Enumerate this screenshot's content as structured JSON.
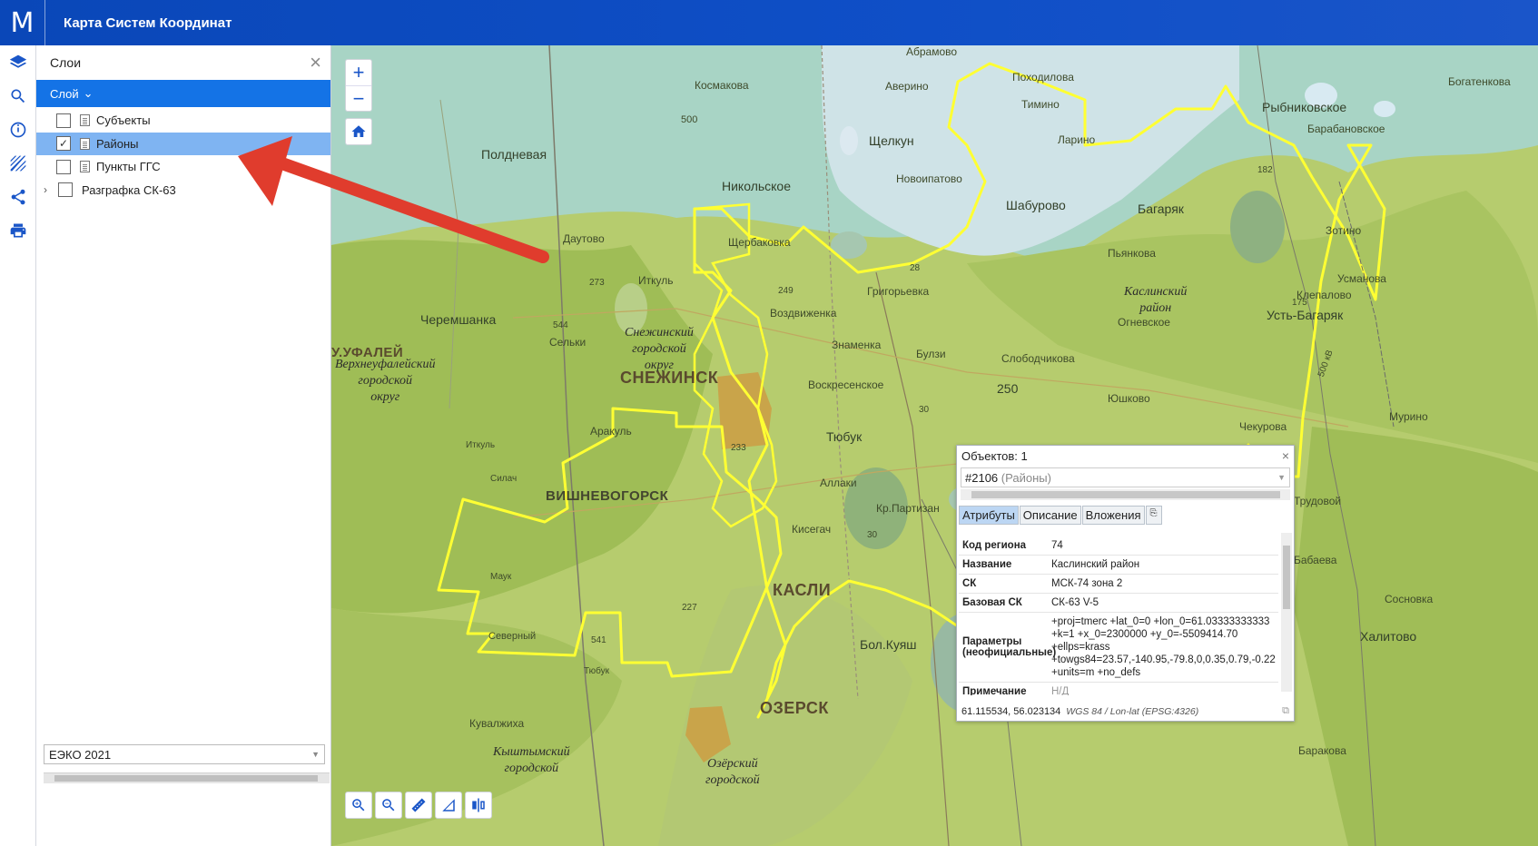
{
  "header": {
    "logo": "M",
    "title": "Карта Систем Координат"
  },
  "toolbar": {
    "tools": [
      "layers-icon",
      "search-icon",
      "info-icon",
      "hatch-icon",
      "share-icon",
      "print-icon"
    ]
  },
  "layers_panel": {
    "title": "Слои",
    "dropdown_label": "Слой",
    "layers": [
      {
        "label": "Субъекты",
        "checked": false,
        "selected": false
      },
      {
        "label": "Районы",
        "checked": true,
        "selected": true
      },
      {
        "label": "Пункты ГГС",
        "checked": false,
        "selected": false
      },
      {
        "label": "Разграфка СК-63",
        "checked": false,
        "selected": false,
        "expandable": true
      }
    ],
    "basemap": "ЕЭКО 2021"
  },
  "map": {
    "labels": {
      "abramovo": "Абрамово",
      "poxodilova": "Походилова",
      "bogatenkova": "Богатенкова",
      "kosmakova": "Космакова",
      "averino": "Аверино",
      "timino": "Тимино",
      "rybnikovskoe": "Рыбниковское",
      "poldnevaya": "Полдневая",
      "shchelkun": "Щелкун",
      "larino": "Ларино",
      "barabanovskoe": "Барабановское",
      "nikolskoe": "Никольское",
      "novoipatovo": "Новоипатово",
      "shaburovo": "Шабурово",
      "bagaryak": "Багаряк",
      "zotino": "Зотино",
      "dautovo": "Даутово",
      "shcherbakovka": "Щербаковка",
      "pyankova": "Пьянкова",
      "itkul": "Иткуль",
      "grigorevka": "Григорьевка",
      "usmanova": "Усманова",
      "cheremshanka": "Черемшанка",
      "vozdvizhenka": "Воздвиженка",
      "klepalovo": "Клепалово",
      "ognevskoe": "Огневское",
      "ust_bagaryak": "Усть-Багаряк",
      "selki": "Сельки",
      "znamenka": "Знаменка",
      "bulzi": "Булзи",
      "slobodchikova": "Слободчикова",
      "ufaley": "У.УФАЛЕЙ",
      "snezhinsk": "СНЕЖИНСК",
      "voskresenskoe": "Воскресенское",
      "yushkovo": "Юшково",
      "arakul": "Аракуль",
      "tyubuk": "Тюбук",
      "murino": "Мурино",
      "chekurova": "Чекурова",
      "itkul2": "Иткуль",
      "silach": "Силач",
      "vishnevogorsk": "ВИШНЕВОГОРСК",
      "allaki": "Аллаки",
      "kr_partizan": "Кр.Партизан",
      "trudovoy": "Трудовой",
      "kisegach": "Кисегач",
      "maук": "Маук",
      "kasli": "КАСЛИ",
      "babaeva": "Бабаева",
      "sosnovka": "Сосновка",
      "severny": "Северный",
      "haliтova": "Халитово",
      "tyubuk2": "Тюбук",
      "bol_kuyash": "Бол.Куяш",
      "ozersk": "ОЗЕРСК",
      "kuvalzhiha": "Кувалжиха",
      "barakova": "Баракова",
      "n250": "250",
      "n273": "273",
      "n544": "544",
      "n233": "233",
      "n541": "541",
      "n227": "227",
      "n500": "500",
      "n182": "182",
      "n175": "175",
      "n249": "249",
      "n28": "28",
      "n30": "30",
      "n30b": "30",
      "kv500": "500 кВ"
    },
    "regions": {
      "kaslinsky": "Каслинский\nрайон",
      "snezhinsky": "Снежинский\nгородской\nокруг",
      "verkhneufaleysky": "Верхнеуфалейский\nгородской\nокруг",
      "kyshtymsky": "Кыштымский\nгородской",
      "ozersky": "Озёрский\nгородской"
    }
  },
  "popup": {
    "title": "Объектов: 1",
    "object_id": "#2106",
    "object_layer": "(Районы)",
    "tabs": [
      "Атрибуты",
      "Описание",
      "Вложения"
    ],
    "attributes": [
      {
        "key": "Код региона",
        "value": "74"
      },
      {
        "key": "Название",
        "value": "Каслинский район"
      },
      {
        "key": "СК",
        "value": "МСК-74 зона 2"
      },
      {
        "key": "Базовая СК",
        "value": "СК-63 V-5"
      },
      {
        "key": "Параметры (неофициальные)",
        "value": "+proj=tmerc +lat_0=0 +lon_0=61.03333333333 +k=1 +x_0=2300000 +y_0=-5509414.70 +ellps=krass +towgs84=23.57,-140.95,-79.8,0,0.35,0.79,-0.22 +units=m +no_defs"
      },
      {
        "key": "Примечание",
        "value": "Н/Д",
        "muted": true
      }
    ],
    "coordinates": "61.115534, 56.023134",
    "crs": "WGS 84 / Lon-lat (EPSG:4326)"
  },
  "colors": {
    "header": "#0f4fc7",
    "accent": "#1473e6",
    "boundary": "#ffff33",
    "arrow": "#e03c2d"
  }
}
